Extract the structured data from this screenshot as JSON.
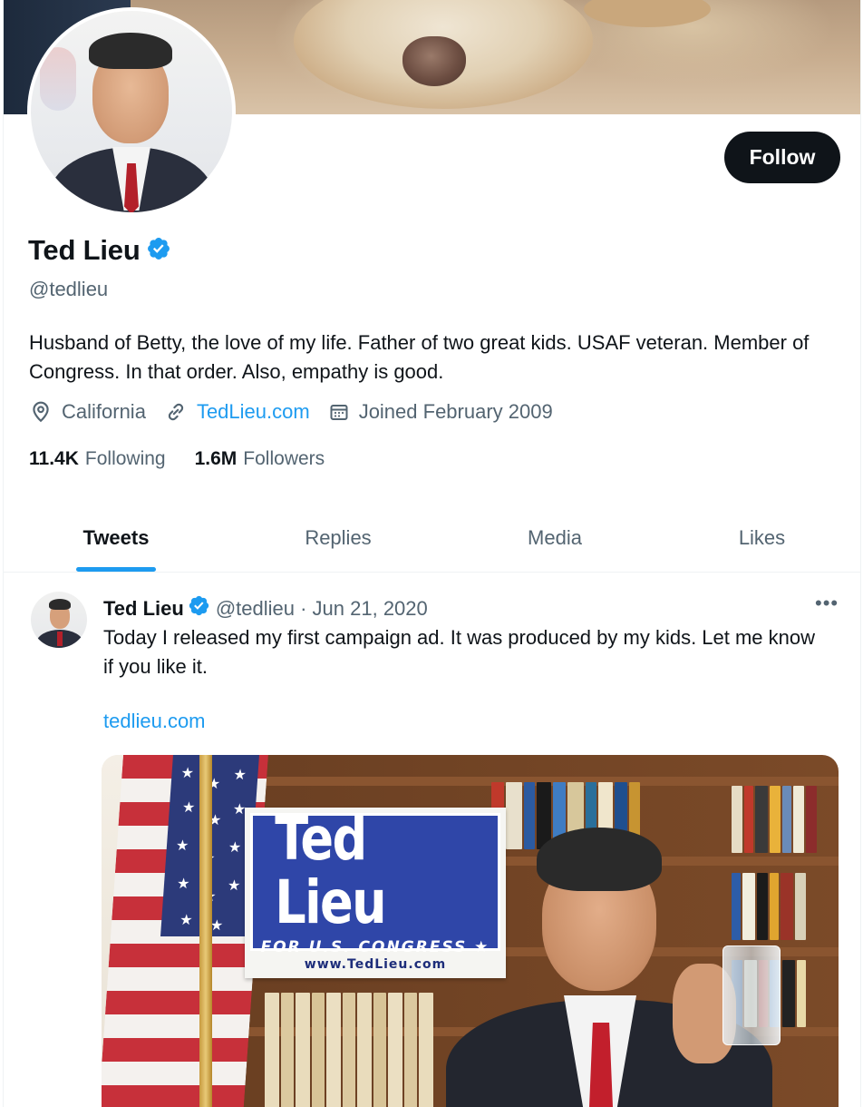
{
  "profile": {
    "name": "Ted Lieu",
    "handle": "@tedlieu",
    "verified_icon": "verified-badge-icon",
    "bio": "Husband of Betty, the love of my life. Father of two great kids. USAF veteran. Member of Congress. In that order. Also, empathy is good.",
    "location": "California",
    "website": "TedLieu.com",
    "joined": "Joined February 2009",
    "following_count": "11.4K",
    "following_label": "Following",
    "followers_count": "1.6M",
    "followers_label": "Followers",
    "follow_button": "Follow"
  },
  "tabs": [
    {
      "label": "Tweets",
      "active": true
    },
    {
      "label": "Replies",
      "active": false
    },
    {
      "label": "Media",
      "active": false
    },
    {
      "label": "Likes",
      "active": false
    }
  ],
  "tweet": {
    "name": "Ted Lieu",
    "handle_date": "@tedlieu · Jun 21, 2020",
    "more": "•••",
    "text": "Today I released my first campaign ad. It was produced by my kids. Let me know if you like it.",
    "link": "tedlieu.com",
    "media": {
      "sign_title": "Ted Lieu",
      "sign_subtitle": "FOR U.S. CONGRESS ★",
      "sign_url": "www.TedLieu.com"
    }
  },
  "colors": {
    "accent": "#1d9bf0",
    "text_primary": "#0f1419",
    "text_secondary": "#536471",
    "button_bg": "#0f1419"
  }
}
